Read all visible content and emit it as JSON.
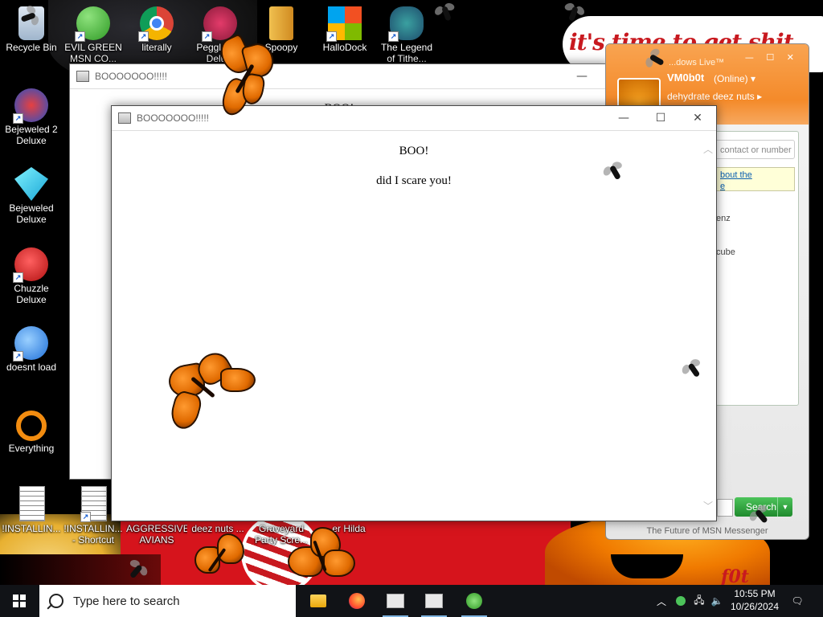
{
  "wallpaper": {
    "slogan": "it's time to get shit",
    "corner_text": "f0t"
  },
  "desktop_icons": [
    {
      "label": "Recycle Bin",
      "icon": "recycle-bin-icon"
    },
    {
      "label": "EVIL GREEN MSN CO...",
      "icon": "msn-messenger-icon"
    },
    {
      "label": "literally",
      "icon": "chrome-icon"
    },
    {
      "label": "Peggle N... Delu...",
      "icon": "peggle-icon"
    },
    {
      "label": "Spoopy",
      "icon": "spoopy-folder-icon"
    },
    {
      "label": "HalloDock",
      "icon": "windows-logo-icon"
    },
    {
      "label": "The Legend of Tithe...",
      "icon": "zelda-character-icon"
    },
    {
      "label": "Bejeweled 2 Deluxe",
      "icon": "bejeweled-2-icon"
    },
    {
      "label": "Bejeweled Deluxe",
      "icon": "bejeweled-gem-icon"
    },
    {
      "label": "Chuzzle Deluxe",
      "icon": "chuzzle-icon"
    },
    {
      "label": "doesnt load",
      "icon": "thunderbird-icon"
    },
    {
      "label": "Everything",
      "icon": "everything-search-icon"
    },
    {
      "label": "!INSTALLIN...",
      "icon": "document-icon"
    },
    {
      "label": "!INSTALLIN... - Shortcut",
      "icon": "document-shortcut-icon"
    },
    {
      "label": "AGGRESSIVE AVIANS",
      "icon": "game-icon"
    },
    {
      "label": "deez nuts ...",
      "icon": "file-icon"
    },
    {
      "label": "Graveyard Party Scre...",
      "icon": "screensaver-icon"
    },
    {
      "label": "...er Hilda",
      "icon": "file-icon"
    }
  ],
  "left_labels": {
    "partial_1": "fa",
    "partial_2": "N"
  },
  "back_window": {
    "title": "BOOOOOOO!!!!!",
    "peek_text": "BOO!",
    "minimize": "—"
  },
  "front_window": {
    "title": "BOOOOOOO!!!!!",
    "heading": "BOO!",
    "message": "did I scare you!",
    "minimize": "—",
    "maximize": "☐",
    "close": "✕"
  },
  "msn": {
    "app_title": "...dows Live™",
    "user_name": "VM0b0t",
    "status": "(Online) ▾",
    "personal_message": "dehydrate deez nuts ▸",
    "search_placeholder": "contact or number",
    "note_line1": "bout the",
    "note_line2": "e",
    "contact_1": "enz",
    "contact_2": "cube",
    "search_button": "Search",
    "footer": "The Future of MSN Messenger",
    "controls": "—  ☐  ✕"
  },
  "taskbar": {
    "search_placeholder": "Type here to search",
    "time": "10:55 PM",
    "date": "10/26/2024",
    "apps": [
      "file-explorer-icon",
      "firefox-icon",
      "boo-window-icon",
      "boo-window-icon",
      "msn-icon"
    ]
  }
}
